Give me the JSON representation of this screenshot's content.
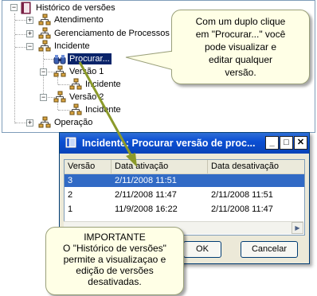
{
  "tree": {
    "root": "Histórico de versões",
    "items": [
      {
        "label": "Atendimento"
      },
      {
        "label": "Gerenciamento de Processos"
      },
      {
        "label": "Incidente"
      },
      {
        "label": "Procurar..."
      },
      {
        "label": "Versão 1"
      },
      {
        "label": "Incidente"
      },
      {
        "label": "Versão 2"
      },
      {
        "label": "Incidente"
      },
      {
        "label": "Operação"
      }
    ]
  },
  "callout_top": {
    "lines": [
      "Com um duplo clique",
      "em \"Procurar...\" você",
      "pode visualizar e",
      "editar qualquer",
      "versão."
    ]
  },
  "dialog": {
    "title": "Incidente: Procurar versão de proc...",
    "minimize": "_",
    "maximize": "□",
    "close": "✕",
    "columns": [
      "Versão",
      "Data ativação",
      "Data desativação"
    ],
    "rows": [
      {
        "versao": "3",
        "ativacao": "2/11/2008 11:51",
        "desativacao": ""
      },
      {
        "versao": "2",
        "ativacao": "2/11/2008 11:47",
        "desativacao": "2/11/2008 11:51"
      },
      {
        "versao": "1",
        "ativacao": "11/9/2008 16:22",
        "desativacao": "2/11/2008 11:47"
      }
    ],
    "ok_label": "OK",
    "cancel_label": "Cancelar"
  },
  "callout_bottom": {
    "lines": [
      "IMPORTANTE",
      "O \"Histórico de versões\"",
      "permite a visualizaçao e",
      "edição de versões",
      "desativadas."
    ]
  },
  "colors": {
    "selection": "#0a246a",
    "row_selected": "#316ac5",
    "callout_bg": "#ffffe6",
    "titlebar": "#0b4fd4"
  }
}
